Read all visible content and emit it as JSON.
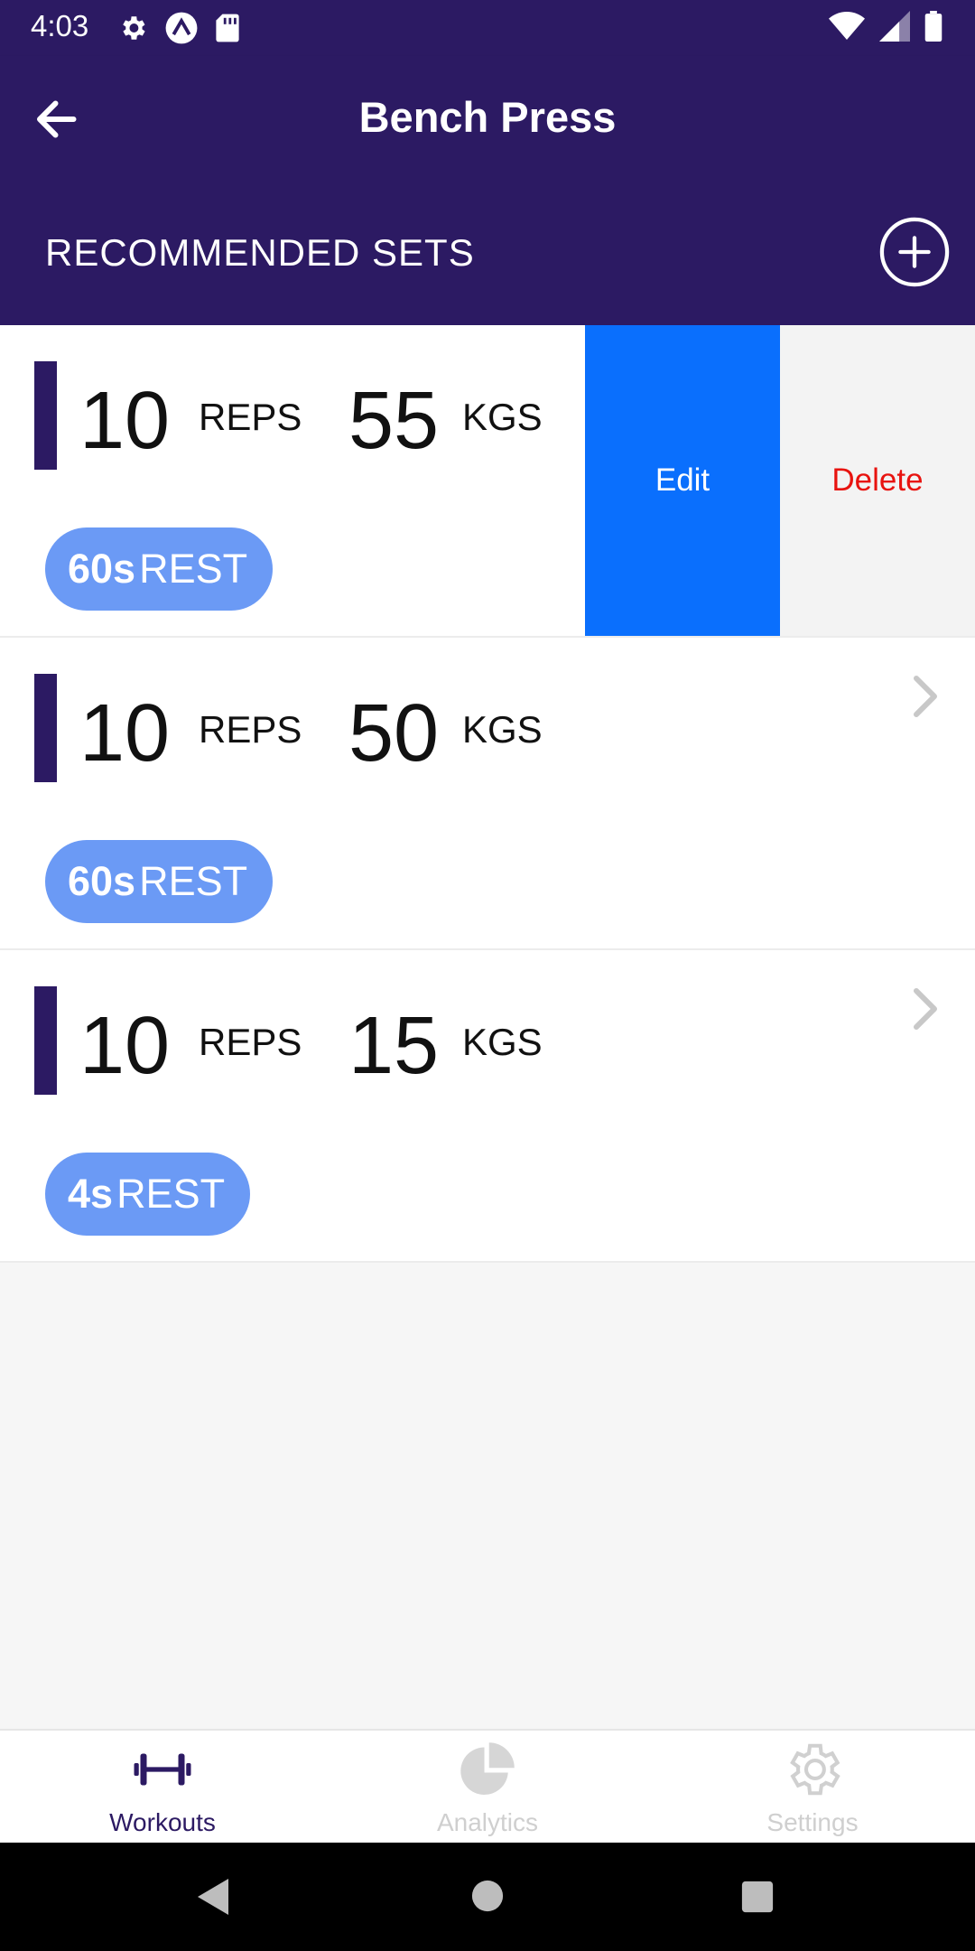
{
  "status_bar": {
    "time": "4:03",
    "left_icons": [
      "gear-icon",
      "expo-icon",
      "sd-card-icon"
    ],
    "right_icons": [
      "wifi-icon",
      "signal-icon",
      "battery-icon"
    ]
  },
  "app_bar": {
    "title": "Bench Press",
    "back_icon": "arrow-left-icon"
  },
  "section": {
    "title": "RECOMMENDED SETS",
    "add_icon": "plus-circle-icon"
  },
  "sets": [
    {
      "reps": "10",
      "reps_label": "REPS",
      "weight": "55",
      "weight_label": "KGS",
      "rest_value": "60s",
      "rest_label": "REST",
      "swiped": true
    },
    {
      "reps": "10",
      "reps_label": "REPS",
      "weight": "50",
      "weight_label": "KGS",
      "rest_value": "60s",
      "rest_label": "REST",
      "swiped": false
    },
    {
      "reps": "10",
      "reps_label": "REPS",
      "weight": "15",
      "weight_label": "KGS",
      "rest_value": "4s",
      "rest_label": "REST",
      "swiped": false
    }
  ],
  "swipe_actions": {
    "edit_label": "Edit",
    "delete_label": "Delete"
  },
  "bottom_nav": {
    "tabs": [
      {
        "label": "Workouts",
        "icon": "dumbbell-icon",
        "active": true
      },
      {
        "label": "Analytics",
        "icon": "pie-chart-icon",
        "active": false
      },
      {
        "label": "Settings",
        "icon": "gear-icon",
        "active": false
      }
    ]
  },
  "system_nav": {
    "icons": [
      "back-triangle-icon",
      "home-circle-icon",
      "recents-square-icon"
    ]
  },
  "colors": {
    "primary": "#2c1a63",
    "rest_pill": "#6b9af5",
    "edit": "#0a6ffd",
    "delete_text": "#e8130f"
  }
}
